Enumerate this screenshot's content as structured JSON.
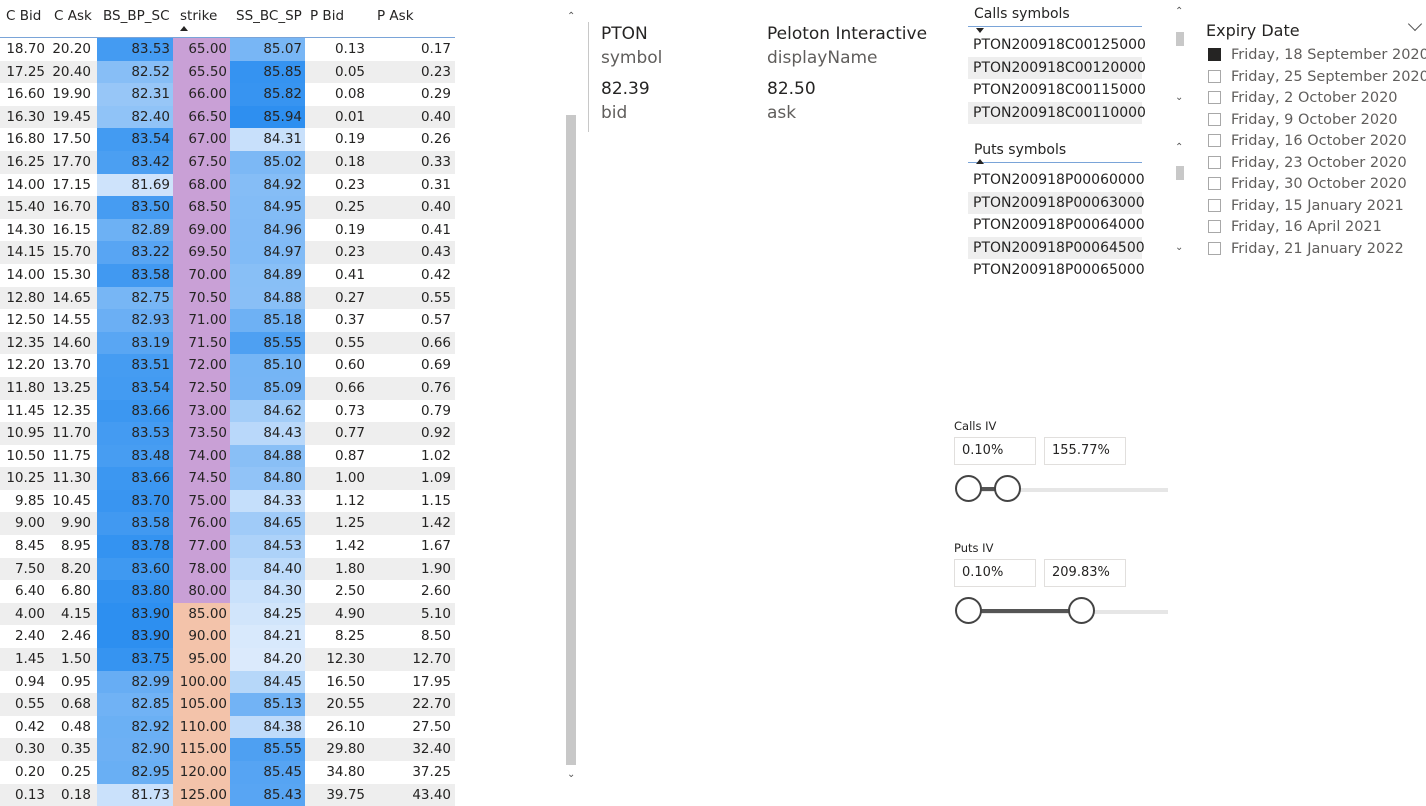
{
  "table": {
    "headers": [
      "C Bid",
      "C Ask",
      "BS_BP_SC",
      "strike",
      "SS_BC_SP",
      "P Bid",
      "P Ask"
    ],
    "sorted_column": "strike",
    "rows": [
      [
        "18.70",
        "20.20",
        "83.53",
        "65.00",
        "85.07",
        "0.13",
        "0.17"
      ],
      [
        "17.25",
        "20.40",
        "82.52",
        "65.50",
        "85.85",
        "0.05",
        "0.23"
      ],
      [
        "16.60",
        "19.90",
        "82.31",
        "66.00",
        "85.82",
        "0.08",
        "0.29"
      ],
      [
        "16.30",
        "19.45",
        "82.40",
        "66.50",
        "85.94",
        "0.01",
        "0.40"
      ],
      [
        "16.80",
        "17.50",
        "83.54",
        "67.00",
        "84.31",
        "0.19",
        "0.26"
      ],
      [
        "16.25",
        "17.70",
        "83.42",
        "67.50",
        "85.02",
        "0.18",
        "0.33"
      ],
      [
        "14.00",
        "17.15",
        "81.69",
        "68.00",
        "84.92",
        "0.23",
        "0.31"
      ],
      [
        "15.40",
        "16.70",
        "83.50",
        "68.50",
        "84.95",
        "0.25",
        "0.40"
      ],
      [
        "14.30",
        "16.15",
        "82.89",
        "69.00",
        "84.96",
        "0.19",
        "0.41"
      ],
      [
        "14.15",
        "15.70",
        "83.22",
        "69.50",
        "84.97",
        "0.23",
        "0.43"
      ],
      [
        "14.00",
        "15.30",
        "83.58",
        "70.00",
        "84.89",
        "0.41",
        "0.42"
      ],
      [
        "12.80",
        "14.65",
        "82.75",
        "70.50",
        "84.88",
        "0.27",
        "0.55"
      ],
      [
        "12.50",
        "14.55",
        "82.93",
        "71.00",
        "85.18",
        "0.37",
        "0.57"
      ],
      [
        "12.35",
        "14.60",
        "83.19",
        "71.50",
        "85.55",
        "0.55",
        "0.66"
      ],
      [
        "12.20",
        "13.70",
        "83.51",
        "72.00",
        "85.10",
        "0.60",
        "0.69"
      ],
      [
        "11.80",
        "13.25",
        "83.54",
        "72.50",
        "85.09",
        "0.66",
        "0.76"
      ],
      [
        "11.45",
        "12.35",
        "83.66",
        "73.00",
        "84.62",
        "0.73",
        "0.79"
      ],
      [
        "10.95",
        "11.70",
        "83.53",
        "73.50",
        "84.43",
        "0.77",
        "0.92"
      ],
      [
        "10.50",
        "11.75",
        "83.48",
        "74.00",
        "84.88",
        "0.87",
        "1.02"
      ],
      [
        "10.25",
        "11.30",
        "83.66",
        "74.50",
        "84.80",
        "1.00",
        "1.09"
      ],
      [
        "9.85",
        "10.45",
        "83.70",
        "75.00",
        "84.33",
        "1.12",
        "1.15"
      ],
      [
        "9.00",
        "9.90",
        "83.58",
        "76.00",
        "84.65",
        "1.25",
        "1.42"
      ],
      [
        "8.45",
        "8.95",
        "83.78",
        "77.00",
        "84.53",
        "1.42",
        "1.67"
      ],
      [
        "7.50",
        "8.20",
        "83.60",
        "78.00",
        "84.40",
        "1.80",
        "1.90"
      ],
      [
        "6.40",
        "6.80",
        "83.80",
        "80.00",
        "84.30",
        "2.50",
        "2.60"
      ],
      [
        "4.00",
        "4.15",
        "83.90",
        "85.00",
        "84.25",
        "4.90",
        "5.10"
      ],
      [
        "2.40",
        "2.46",
        "83.90",
        "90.00",
        "84.21",
        "8.25",
        "8.50"
      ],
      [
        "1.45",
        "1.50",
        "83.75",
        "95.00",
        "84.20",
        "12.30",
        "12.70"
      ],
      [
        "0.94",
        "0.95",
        "82.99",
        "100.00",
        "84.45",
        "16.50",
        "17.95"
      ],
      [
        "0.55",
        "0.68",
        "82.85",
        "105.00",
        "85.13",
        "20.55",
        "22.70"
      ],
      [
        "0.42",
        "0.48",
        "82.92",
        "110.00",
        "84.38",
        "26.10",
        "27.50"
      ],
      [
        "0.30",
        "0.35",
        "82.90",
        "115.00",
        "85.55",
        "29.80",
        "32.40"
      ],
      [
        "0.20",
        "0.25",
        "82.95",
        "120.00",
        "85.45",
        "34.80",
        "37.25"
      ],
      [
        "0.13",
        "0.18",
        "81.73",
        "125.00",
        "85.43",
        "39.75",
        "43.40"
      ]
    ],
    "colors": {
      "strike_below_price": "#c9a0d6",
      "strike_above_price": "#f3c3aa",
      "blue_dark": "#2d8ff0",
      "blue_light": "#dbeafc"
    }
  },
  "card": {
    "symbol_value": "PTON",
    "symbol_label": "symbol",
    "name_value": "Peloton Interactive",
    "name_label": "displayName",
    "bid_value": "82.39",
    "bid_label": "bid",
    "ask_value": "82.50",
    "ask_label": "ask"
  },
  "calls": {
    "title": "Calls symbols",
    "items": [
      "PTON200918C00125000",
      "PTON200918C00120000",
      "PTON200918C00115000",
      "PTON200918C00110000"
    ]
  },
  "puts": {
    "title": "Puts symbols",
    "items": [
      "PTON200918P00060000",
      "PTON200918P00063000",
      "PTON200918P00064000",
      "PTON200918P00064500",
      "PTON200918P00065000"
    ]
  },
  "calls_iv": {
    "label": "Calls IV",
    "min": "0.10%",
    "max": "155.77%"
  },
  "puts_iv": {
    "label": "Puts IV",
    "min": "0.10%",
    "max": "209.83%"
  },
  "expiry": {
    "title": "Expiry Date",
    "options": [
      {
        "label": "Friday, 18 September 2020",
        "checked": true
      },
      {
        "label": "Friday, 25 September 2020",
        "checked": false
      },
      {
        "label": "Friday, 2 October 2020",
        "checked": false
      },
      {
        "label": "Friday, 9 October 2020",
        "checked": false
      },
      {
        "label": "Friday, 16 October 2020",
        "checked": false
      },
      {
        "label": "Friday, 23 October 2020",
        "checked": false
      },
      {
        "label": "Friday, 30 October 2020",
        "checked": false
      },
      {
        "label": "Friday, 15 January 2021",
        "checked": false
      },
      {
        "label": "Friday, 16 April 2021",
        "checked": false
      },
      {
        "label": "Friday, 21 January 2022",
        "checked": false
      }
    ]
  }
}
